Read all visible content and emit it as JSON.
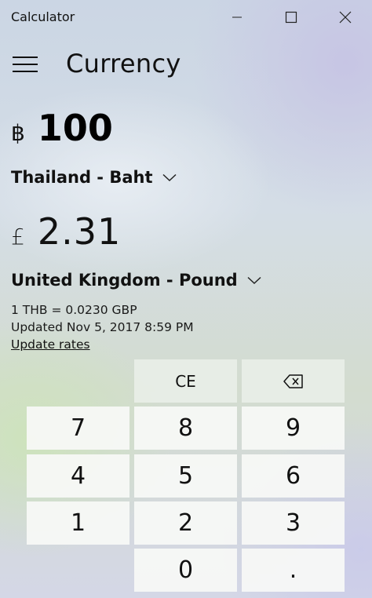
{
  "window": {
    "title": "Calculator"
  },
  "header": {
    "mode_title": "Currency"
  },
  "from": {
    "symbol": "฿",
    "value": "100",
    "unit": "Thailand - Baht"
  },
  "to": {
    "symbol": "£",
    "value": "2.31",
    "unit": "United Kingdom - Pound"
  },
  "rates": {
    "rate_line": "1 THB = 0.0230 GBP",
    "updated_line": "Updated Nov 5, 2017 8:59 PM",
    "update_link": "Update rates"
  },
  "keypad": {
    "ce": "CE",
    "seven": "7",
    "eight": "8",
    "nine": "9",
    "four": "4",
    "five": "5",
    "six": "6",
    "one": "1",
    "two": "2",
    "three": "3",
    "zero": "0",
    "decimal": "."
  },
  "icons": {
    "menu": "hamburger-icon",
    "minimize": "minimize-icon",
    "maximize": "maximize-icon",
    "close": "close-icon",
    "dropdown": "chevron-down-icon",
    "backspace": "backspace-icon"
  }
}
